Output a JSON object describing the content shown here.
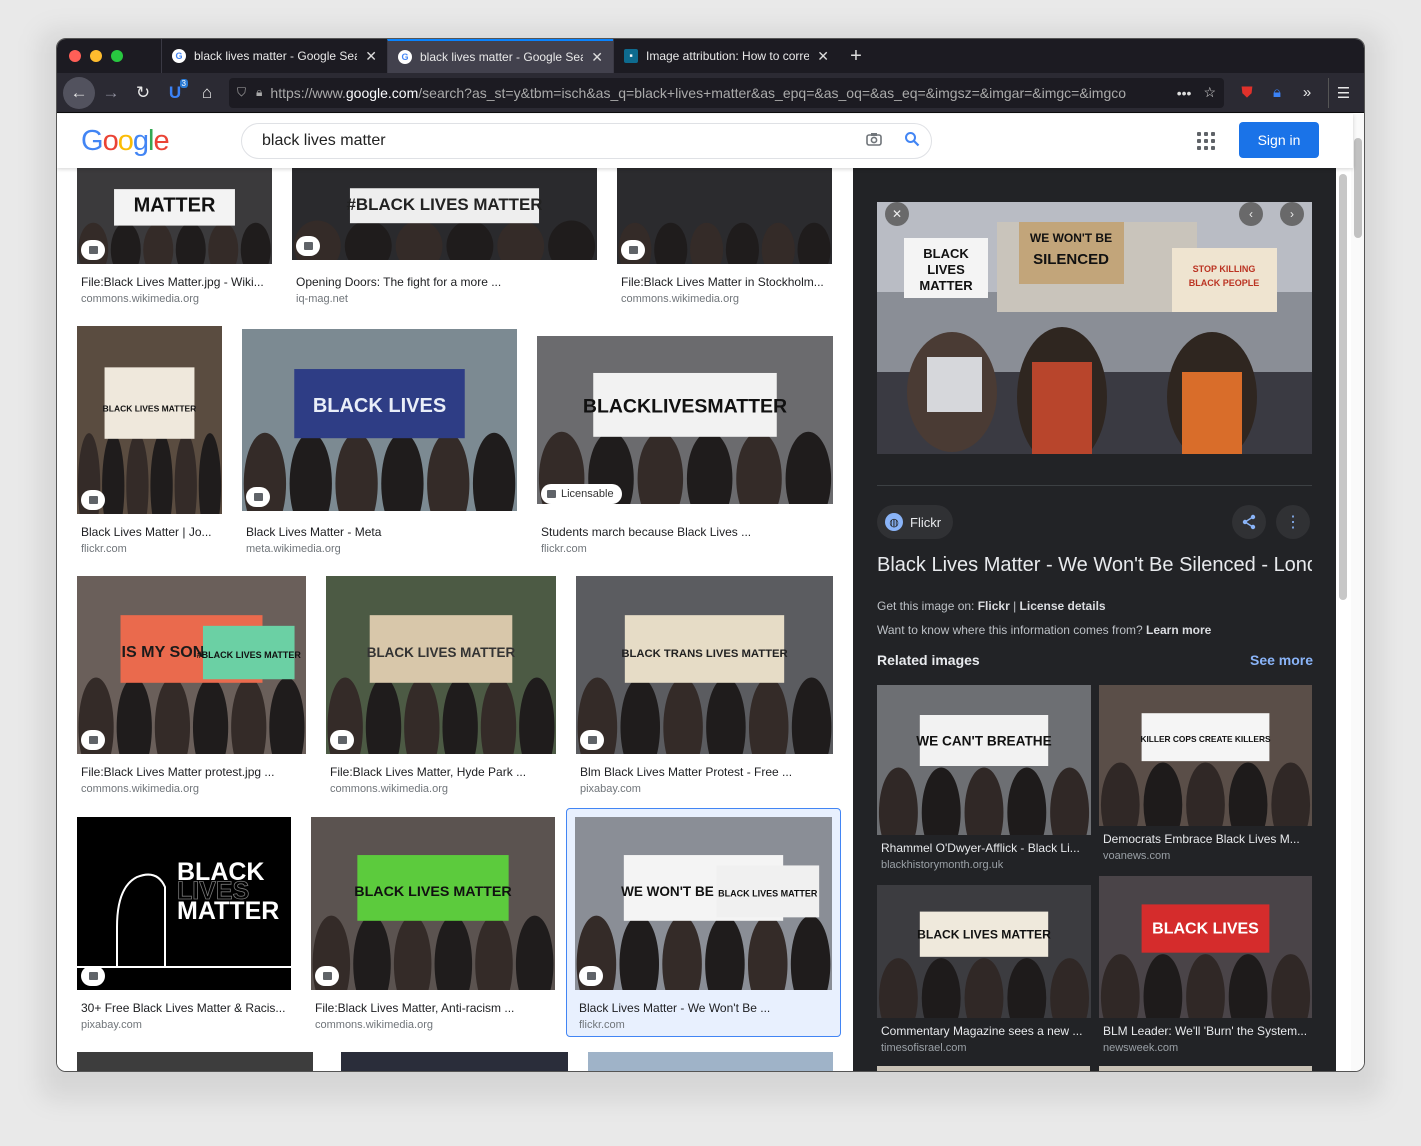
{
  "browser": {
    "tabs": [
      {
        "title": "black lives matter - Google Sea",
        "active": false,
        "favicon": "google-g"
      },
      {
        "title": "black lives matter - Google Sea",
        "active": true,
        "favicon": "google-g"
      },
      {
        "title": "Image attribution: How to corre",
        "active": false,
        "favicon": "site-square"
      }
    ],
    "url_prefix": "https://www.",
    "url_domain": "google.com",
    "url_rest": "/search?as_st=y&tbm=isch&as_q=black+lives+matter&as_epq=&as_oq=&as_eq=&imgsz=&imgar=&imgc=&imgco",
    "extension_badge": "3"
  },
  "header": {
    "logo": "Google",
    "query": "black lives matter",
    "signin_label": "Sign in"
  },
  "results": [
    {
      "caption": "File:Black Lives Matter.jpg - Wiki...",
      "source": "commons.wikimedia.org",
      "sign": "MATTER"
    },
    {
      "caption": "Opening Doors: The fight for a more ...",
      "source": "iq-mag.net",
      "sign": "#BLACK LIVES MATTER"
    },
    {
      "caption": "File:Black Lives Matter in Stockholm...",
      "source": "commons.wikimedia.org",
      "sign": ""
    },
    {
      "caption": "Black Lives Matter | Jo...",
      "source": "flickr.com",
      "sign": "BLACK LIVES MATTER"
    },
    {
      "caption": "Black Lives Matter - Meta",
      "source": "meta.wikimedia.org",
      "sign": "BLACK LIVES"
    },
    {
      "caption": "Students march because Black Lives ...",
      "source": "flickr.com",
      "sign": "BLACKLIVESMATTER",
      "badge": "Licensable"
    },
    {
      "caption": "File:Black Lives Matter protest.jpg ...",
      "source": "commons.wikimedia.org",
      "sign": "IS MY SON NEXT?",
      "sign2": "#BLACK LIVES MATTER"
    },
    {
      "caption": "File:Black Lives Matter, Hyde Park ...",
      "source": "commons.wikimedia.org",
      "sign": "BLACK LIVES MATTER"
    },
    {
      "caption": "Blm Black Lives Matter Protest - Free ...",
      "source": "pixabay.com",
      "sign": "BLACK TRANS LIVES MATTER"
    },
    {
      "caption": "30+ Free Black Lives Matter & Racis...",
      "source": "pixabay.com",
      "sign": "BLACK",
      "sign2": "LIVES",
      "sign3": "MATTER"
    },
    {
      "caption": "File:Black Lives Matter, Anti-racism ...",
      "source": "commons.wikimedia.org",
      "sign": "BLACK LIVES MATTER"
    },
    {
      "caption": "Black Lives Matter - We Won't Be ...",
      "source": "flickr.com",
      "sign": "WE WON'T BE SILENCED",
      "sign2": "BLACK LIVES MATTER"
    }
  ],
  "panel": {
    "source_chip": "Flickr",
    "title": "Black Lives Matter - We Won't Be Silenced - Lond",
    "get_image_prefix": "Get this image on: ",
    "get_image_site": "Flickr",
    "license_sep": " | ",
    "license_label": "License details",
    "info_question": "Want to know where this information comes from? ",
    "learn_more": "Learn more",
    "related_heading": "Related images",
    "see_more": "See more",
    "hero_sign1": "BLACK LIVES MATTER",
    "hero_sign2": "WE WON'T BE SILENCED",
    "related": [
      {
        "caption": "Rhammel O'Dwyer-Afflick - Black Li...",
        "source": "blackhistorymonth.org.uk",
        "sign": "WE CAN'T BREATHE"
      },
      {
        "caption": "Democrats Embrace Black Lives M...",
        "source": "voanews.com",
        "sign": "KILLER COPS CREATE KILLERS"
      },
      {
        "caption": "Commentary Magazine sees a new ...",
        "source": "timesofisrael.com",
        "sign": "BLACK LIVES MATTER"
      },
      {
        "caption": "BLM Leader: We'll 'Burn' the System...",
        "source": "newsweek.com",
        "sign": "BLACK LIVES"
      }
    ]
  },
  "colors": {
    "accent": "#1a73e8",
    "panel_bg": "#222326",
    "link_blue": "#8ab4f8"
  }
}
